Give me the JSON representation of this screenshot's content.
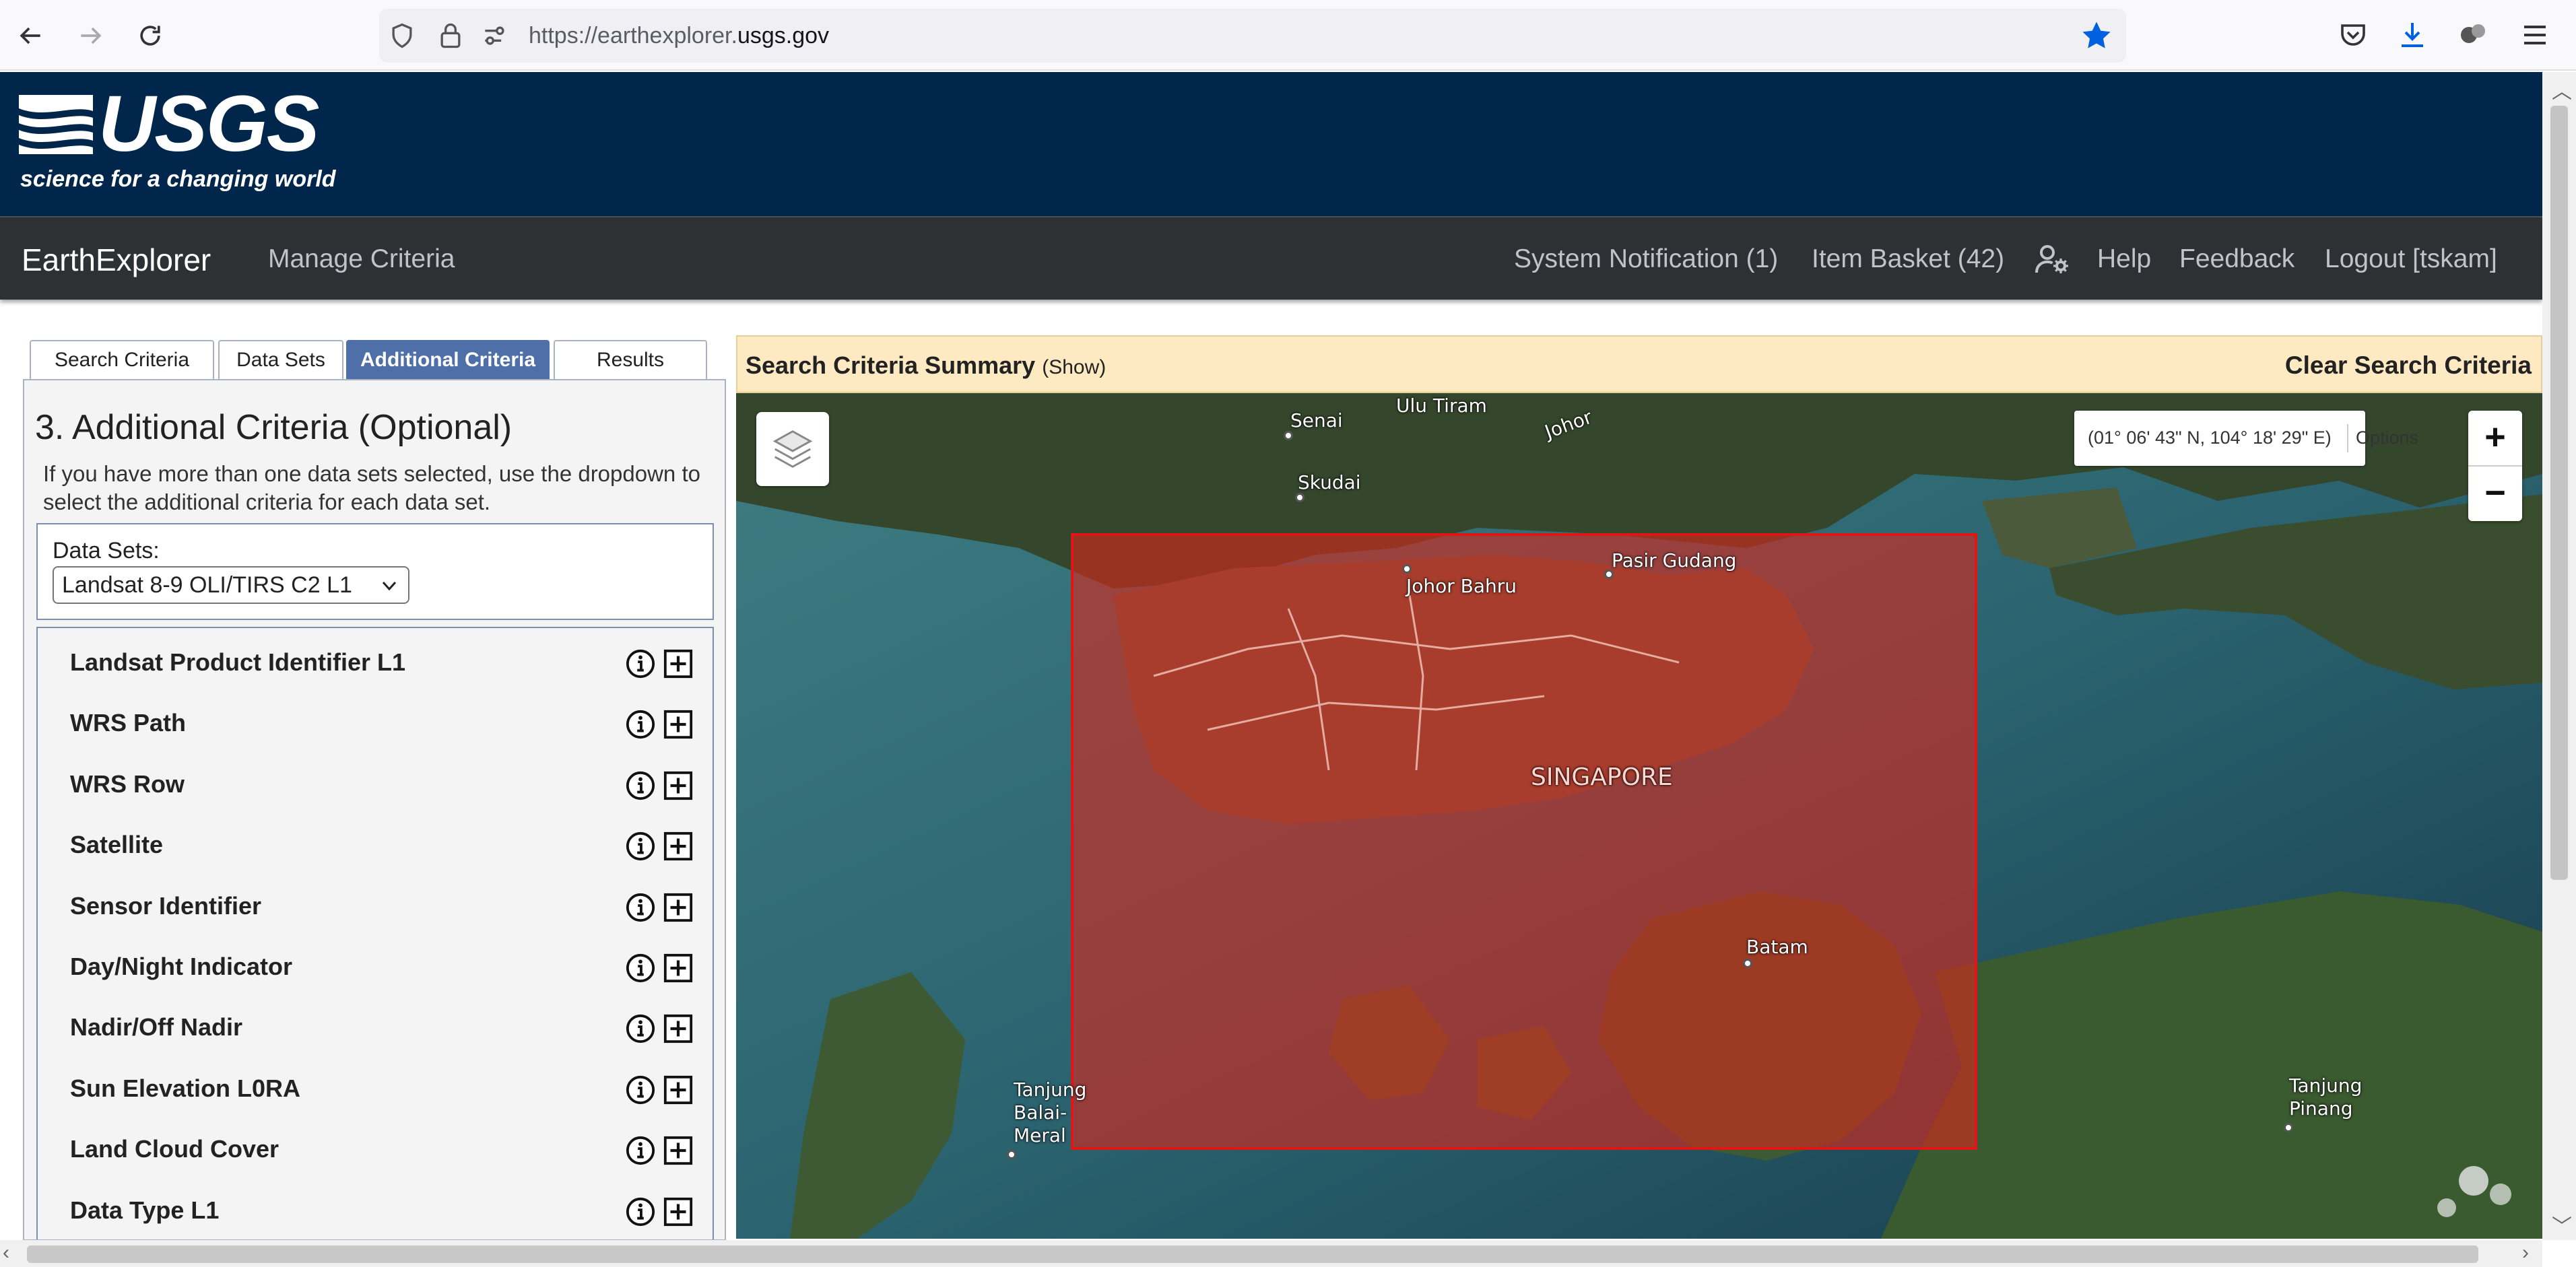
{
  "browser": {
    "url_prefix": "https://earthexplorer.",
    "url_domain": "usgs.gov"
  },
  "icons": {
    "back": "back-arrow-icon",
    "forward": "forward-arrow-icon",
    "reload": "reload-icon",
    "shield": "shield-icon",
    "lock": "lock-icon",
    "permissions": "permissions-icon",
    "bookmark": "bookmark-star-icon",
    "pocket": "pocket-icon",
    "download": "download-icon",
    "extensions": "extensions-icon",
    "menu": "hamburger-menu-icon",
    "layers": "layers-icon",
    "info": "info-icon",
    "add": "plus-square-icon",
    "user_settings": "user-gear-icon"
  },
  "banner": {
    "logo": "USGS",
    "tagline": "science for a changing world"
  },
  "nav": {
    "app_title": "EarthExplorer",
    "manage_criteria": "Manage Criteria",
    "system_notification": "System Notification (1)",
    "item_basket": "Item Basket (42)",
    "help": "Help",
    "feedback": "Feedback",
    "logout": "Logout [tskam]"
  },
  "tabs": [
    {
      "label": "Search Criteria",
      "active": false
    },
    {
      "label": "Data Sets",
      "active": false
    },
    {
      "label": "Additional Criteria",
      "active": true
    },
    {
      "label": "Results",
      "active": false
    }
  ],
  "panel": {
    "title": "3. Additional Criteria (Optional)",
    "description": "If you have more than one data sets selected, use the dropdown to select the additional criteria for each data set.",
    "datasets_label": "Data Sets:",
    "datasets_selected": "Landsat 8-9 OLI/TIRS C2 L1"
  },
  "criteria": [
    "Landsat Product Identifier L1",
    "WRS Path",
    "WRS Row",
    "Satellite",
    "Sensor Identifier",
    "Day/Night Indicator",
    "Nadir/Off Nadir",
    "Sun Elevation L0RA",
    "Land Cloud Cover",
    "Data Type L1"
  ],
  "summary": {
    "title": "Search Criteria Summary",
    "show": "(Show)",
    "clear": "Clear Search Criteria"
  },
  "map": {
    "coordinates": "(01° 06' 43\" N, 104° 18' 29\" E)",
    "options": "Options",
    "zoom_in": "+",
    "zoom_out": "−",
    "places": {
      "senai": "Senai",
      "ulu_tiram": "Ulu Tiram",
      "johor": "Johor",
      "skudai": "Skudai",
      "johor_bahru": "Johor Bahru",
      "pasir_gudang": "Pasir Gudang",
      "singapore": "SINGAPORE",
      "batam": "Batam",
      "tanjung_balai_1": "Tanjung",
      "tanjung_balai_2": "Balai-",
      "tanjung_balai_3": "Meral",
      "tanjung_pinang_1": "Tanjung",
      "tanjung_pinang_2": "Pinang"
    },
    "aoi_color": "#d9261c"
  }
}
